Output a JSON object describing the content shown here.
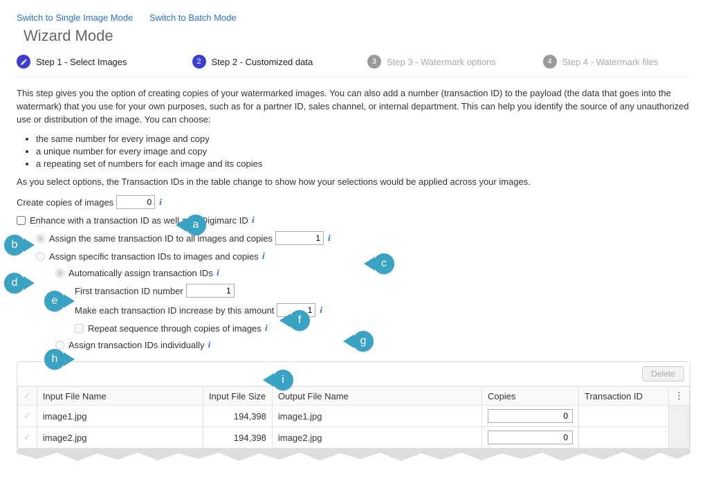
{
  "topLinks": {
    "singleImage": "Switch to Single Image Mode",
    "batch": "Switch to Batch Mode"
  },
  "title": "Wizard Mode",
  "steps": [
    {
      "num": "1",
      "label": "Step 1 - Select Images",
      "state": "done",
      "iconPencil": true
    },
    {
      "num": "2",
      "label": "Step 2 - Customized data",
      "state": "active"
    },
    {
      "num": "3",
      "label": "Step 3 - Watermark options",
      "state": "pending"
    },
    {
      "num": "4",
      "label": "Step 4 - Watermark files",
      "state": "pending"
    }
  ],
  "description": "This step gives you the option of creating copies of your watermarked images. You can also add a number (transaction ID) to the payload (the data that goes into the watermark) that you use for your own purposes, such as for a partner ID, sales channel, or internal department. This can help you identify the source of any unauthorized use or distribution of the image. You can choose:",
  "bullets": [
    "the same number for every image and copy",
    "a unique number for every image and copy",
    "a repeating set of numbers for each image and its copies"
  ],
  "desc2": "As you select options, the Transaction IDs in the table change to show how your selections would be applied across your images.",
  "form": {
    "createCopiesLabel": "Create copies of images",
    "createCopiesValue": "0",
    "enhanceCheckbox": "Enhance with a transaction ID as well as a Digimarc ID",
    "radioSame": "Assign the same transaction ID to all images and copies",
    "radioSameValue": "1",
    "radioSpecific": "Assign specific transaction IDs to images and copies",
    "radioAuto": "Automatically assign transaction IDs",
    "firstTIDLabel": "First transaction ID number",
    "firstTIDValue": "1",
    "increaseLabel": "Make each transaction ID increase by this amount",
    "increaseValue": "1",
    "repeatCheckbox": "Repeat sequence through copies of images",
    "radioIndividual": "Assign transaction IDs individually"
  },
  "table": {
    "deleteBtn": "Delete",
    "headers": {
      "input": "Input File Name",
      "size": "Input File Size",
      "output": "Output File Name",
      "copies": "Copies",
      "tid": "Transaction ID"
    },
    "rows": [
      {
        "input": "image1.jpg",
        "size": "194,398",
        "output": "image1.jpg",
        "copies": "0",
        "tid": ""
      },
      {
        "input": "image2.jpg",
        "size": "194,398",
        "output": "image2.jpg",
        "copies": "0",
        "tid": ""
      }
    ]
  },
  "callouts": {
    "a": "a",
    "b": "b",
    "c": "c",
    "d": "d",
    "e": "e",
    "f": "f",
    "g": "g",
    "h": "h",
    "i": "i"
  },
  "colors": {
    "accent": "#3c3fd1",
    "callout": "#3aa2c2",
    "link": "#2b6fd6"
  }
}
